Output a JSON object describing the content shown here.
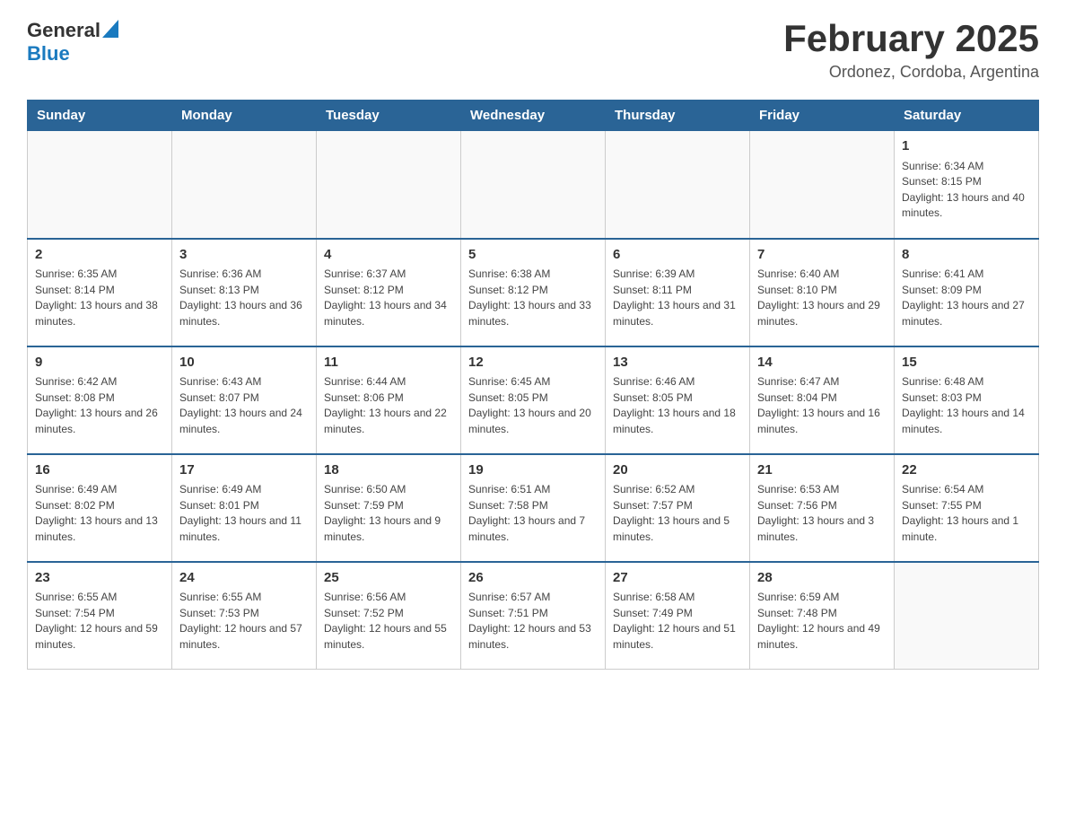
{
  "header": {
    "logo_general": "General",
    "logo_blue": "Blue",
    "month_title": "February 2025",
    "location": "Ordonez, Cordoba, Argentina"
  },
  "days_of_week": [
    "Sunday",
    "Monday",
    "Tuesday",
    "Wednesday",
    "Thursday",
    "Friday",
    "Saturday"
  ],
  "weeks": [
    [
      {
        "day": "",
        "info": ""
      },
      {
        "day": "",
        "info": ""
      },
      {
        "day": "",
        "info": ""
      },
      {
        "day": "",
        "info": ""
      },
      {
        "day": "",
        "info": ""
      },
      {
        "day": "",
        "info": ""
      },
      {
        "day": "1",
        "info": "Sunrise: 6:34 AM\nSunset: 8:15 PM\nDaylight: 13 hours and 40 minutes."
      }
    ],
    [
      {
        "day": "2",
        "info": "Sunrise: 6:35 AM\nSunset: 8:14 PM\nDaylight: 13 hours and 38 minutes."
      },
      {
        "day": "3",
        "info": "Sunrise: 6:36 AM\nSunset: 8:13 PM\nDaylight: 13 hours and 36 minutes."
      },
      {
        "day": "4",
        "info": "Sunrise: 6:37 AM\nSunset: 8:12 PM\nDaylight: 13 hours and 34 minutes."
      },
      {
        "day": "5",
        "info": "Sunrise: 6:38 AM\nSunset: 8:12 PM\nDaylight: 13 hours and 33 minutes."
      },
      {
        "day": "6",
        "info": "Sunrise: 6:39 AM\nSunset: 8:11 PM\nDaylight: 13 hours and 31 minutes."
      },
      {
        "day": "7",
        "info": "Sunrise: 6:40 AM\nSunset: 8:10 PM\nDaylight: 13 hours and 29 minutes."
      },
      {
        "day": "8",
        "info": "Sunrise: 6:41 AM\nSunset: 8:09 PM\nDaylight: 13 hours and 27 minutes."
      }
    ],
    [
      {
        "day": "9",
        "info": "Sunrise: 6:42 AM\nSunset: 8:08 PM\nDaylight: 13 hours and 26 minutes."
      },
      {
        "day": "10",
        "info": "Sunrise: 6:43 AM\nSunset: 8:07 PM\nDaylight: 13 hours and 24 minutes."
      },
      {
        "day": "11",
        "info": "Sunrise: 6:44 AM\nSunset: 8:06 PM\nDaylight: 13 hours and 22 minutes."
      },
      {
        "day": "12",
        "info": "Sunrise: 6:45 AM\nSunset: 8:05 PM\nDaylight: 13 hours and 20 minutes."
      },
      {
        "day": "13",
        "info": "Sunrise: 6:46 AM\nSunset: 8:05 PM\nDaylight: 13 hours and 18 minutes."
      },
      {
        "day": "14",
        "info": "Sunrise: 6:47 AM\nSunset: 8:04 PM\nDaylight: 13 hours and 16 minutes."
      },
      {
        "day": "15",
        "info": "Sunrise: 6:48 AM\nSunset: 8:03 PM\nDaylight: 13 hours and 14 minutes."
      }
    ],
    [
      {
        "day": "16",
        "info": "Sunrise: 6:49 AM\nSunset: 8:02 PM\nDaylight: 13 hours and 13 minutes."
      },
      {
        "day": "17",
        "info": "Sunrise: 6:49 AM\nSunset: 8:01 PM\nDaylight: 13 hours and 11 minutes."
      },
      {
        "day": "18",
        "info": "Sunrise: 6:50 AM\nSunset: 7:59 PM\nDaylight: 13 hours and 9 minutes."
      },
      {
        "day": "19",
        "info": "Sunrise: 6:51 AM\nSunset: 7:58 PM\nDaylight: 13 hours and 7 minutes."
      },
      {
        "day": "20",
        "info": "Sunrise: 6:52 AM\nSunset: 7:57 PM\nDaylight: 13 hours and 5 minutes."
      },
      {
        "day": "21",
        "info": "Sunrise: 6:53 AM\nSunset: 7:56 PM\nDaylight: 13 hours and 3 minutes."
      },
      {
        "day": "22",
        "info": "Sunrise: 6:54 AM\nSunset: 7:55 PM\nDaylight: 13 hours and 1 minute."
      }
    ],
    [
      {
        "day": "23",
        "info": "Sunrise: 6:55 AM\nSunset: 7:54 PM\nDaylight: 12 hours and 59 minutes."
      },
      {
        "day": "24",
        "info": "Sunrise: 6:55 AM\nSunset: 7:53 PM\nDaylight: 12 hours and 57 minutes."
      },
      {
        "day": "25",
        "info": "Sunrise: 6:56 AM\nSunset: 7:52 PM\nDaylight: 12 hours and 55 minutes."
      },
      {
        "day": "26",
        "info": "Sunrise: 6:57 AM\nSunset: 7:51 PM\nDaylight: 12 hours and 53 minutes."
      },
      {
        "day": "27",
        "info": "Sunrise: 6:58 AM\nSunset: 7:49 PM\nDaylight: 12 hours and 51 minutes."
      },
      {
        "day": "28",
        "info": "Sunrise: 6:59 AM\nSunset: 7:48 PM\nDaylight: 12 hours and 49 minutes."
      },
      {
        "day": "",
        "info": ""
      }
    ]
  ]
}
